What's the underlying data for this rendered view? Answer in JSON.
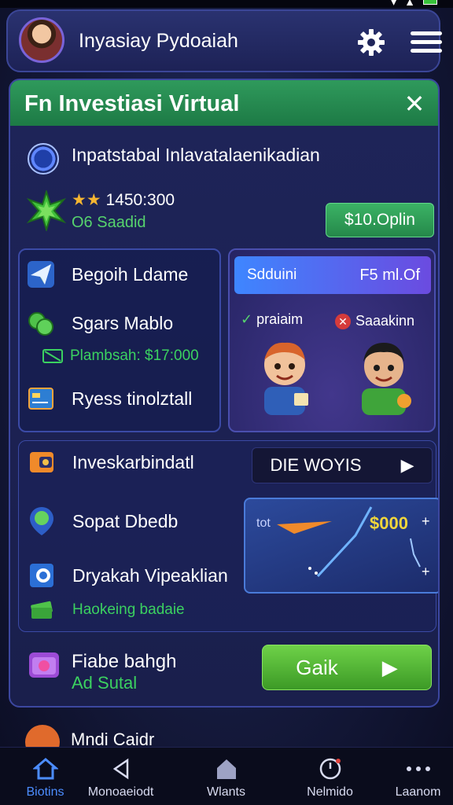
{
  "header": {
    "title": "Inyasiay Pydoaiah",
    "avatar_icon": "user-avatar",
    "settings_icon": "gear-icon",
    "menu_icon": "hamburger-menu-icon"
  },
  "modal": {
    "title": "Fn Investiasi Virtual",
    "close_label": "✕",
    "info": {
      "icon": "clock-icon",
      "text": "Inpatstabal Inlavatalaenikadian"
    },
    "rating": {
      "icon": "star-burst-icon",
      "stars": "★★",
      "value": "1450:300",
      "subtitle": "O6 Saadid",
      "price_button": "$10.Oplin"
    },
    "left_panel": {
      "items": [
        {
          "icon": "paper-plane-icon",
          "label": "Begoih Ldame"
        },
        {
          "icon": "coins-icon",
          "label": "Sgars Mablo"
        },
        {
          "icon": "money-icon",
          "label": "Plambsah: $17:000"
        },
        {
          "icon": "card-icon",
          "label": "Ryess tinolztall"
        }
      ]
    },
    "right_panel": {
      "bar_left": "Sdduini",
      "bar_right": "F5 ml.Of",
      "check_label": "praiaim",
      "cross_label": "Saaakinn"
    },
    "bottom_panel": {
      "items": [
        {
          "icon": "wallet-icon",
          "label": "Inveskarbindatl"
        },
        {
          "icon": "location-pin-icon",
          "label": "Sopat Dbedb"
        },
        {
          "icon": "target-icon",
          "label": "Dryakah Vipeaklian"
        },
        {
          "icon": "cash-stack-icon",
          "label": "Haokeing badaie"
        }
      ],
      "dark_button": "DIE WOYIS",
      "chart": {
        "left_label": "tot",
        "value": "$000",
        "plus": "+"
      }
    },
    "footer": {
      "icon": "camera-icon",
      "label": "Fiabe bahgh",
      "subtitle": "Ad Sutal",
      "go_button": "Gaik"
    }
  },
  "peek_label": "Mndi Caidr",
  "nav": [
    {
      "icon": "home-icon",
      "label": "Biotins",
      "active": true
    },
    {
      "icon": "triangle-back-icon",
      "label": "Monoaeiodt",
      "active": false
    },
    {
      "icon": "house-outline-icon",
      "label": "Wlants",
      "active": false
    },
    {
      "icon": "clock-badge-icon",
      "label": "Nelmido",
      "active": false
    },
    {
      "icon": "more-dots-icon",
      "label": "Laanom",
      "active": false
    }
  ],
  "colors": {
    "accent_green": "#3bb365",
    "accent_blue": "#4c8dff",
    "background": "#151a3d",
    "highlight_gold": "#f1d63b"
  }
}
